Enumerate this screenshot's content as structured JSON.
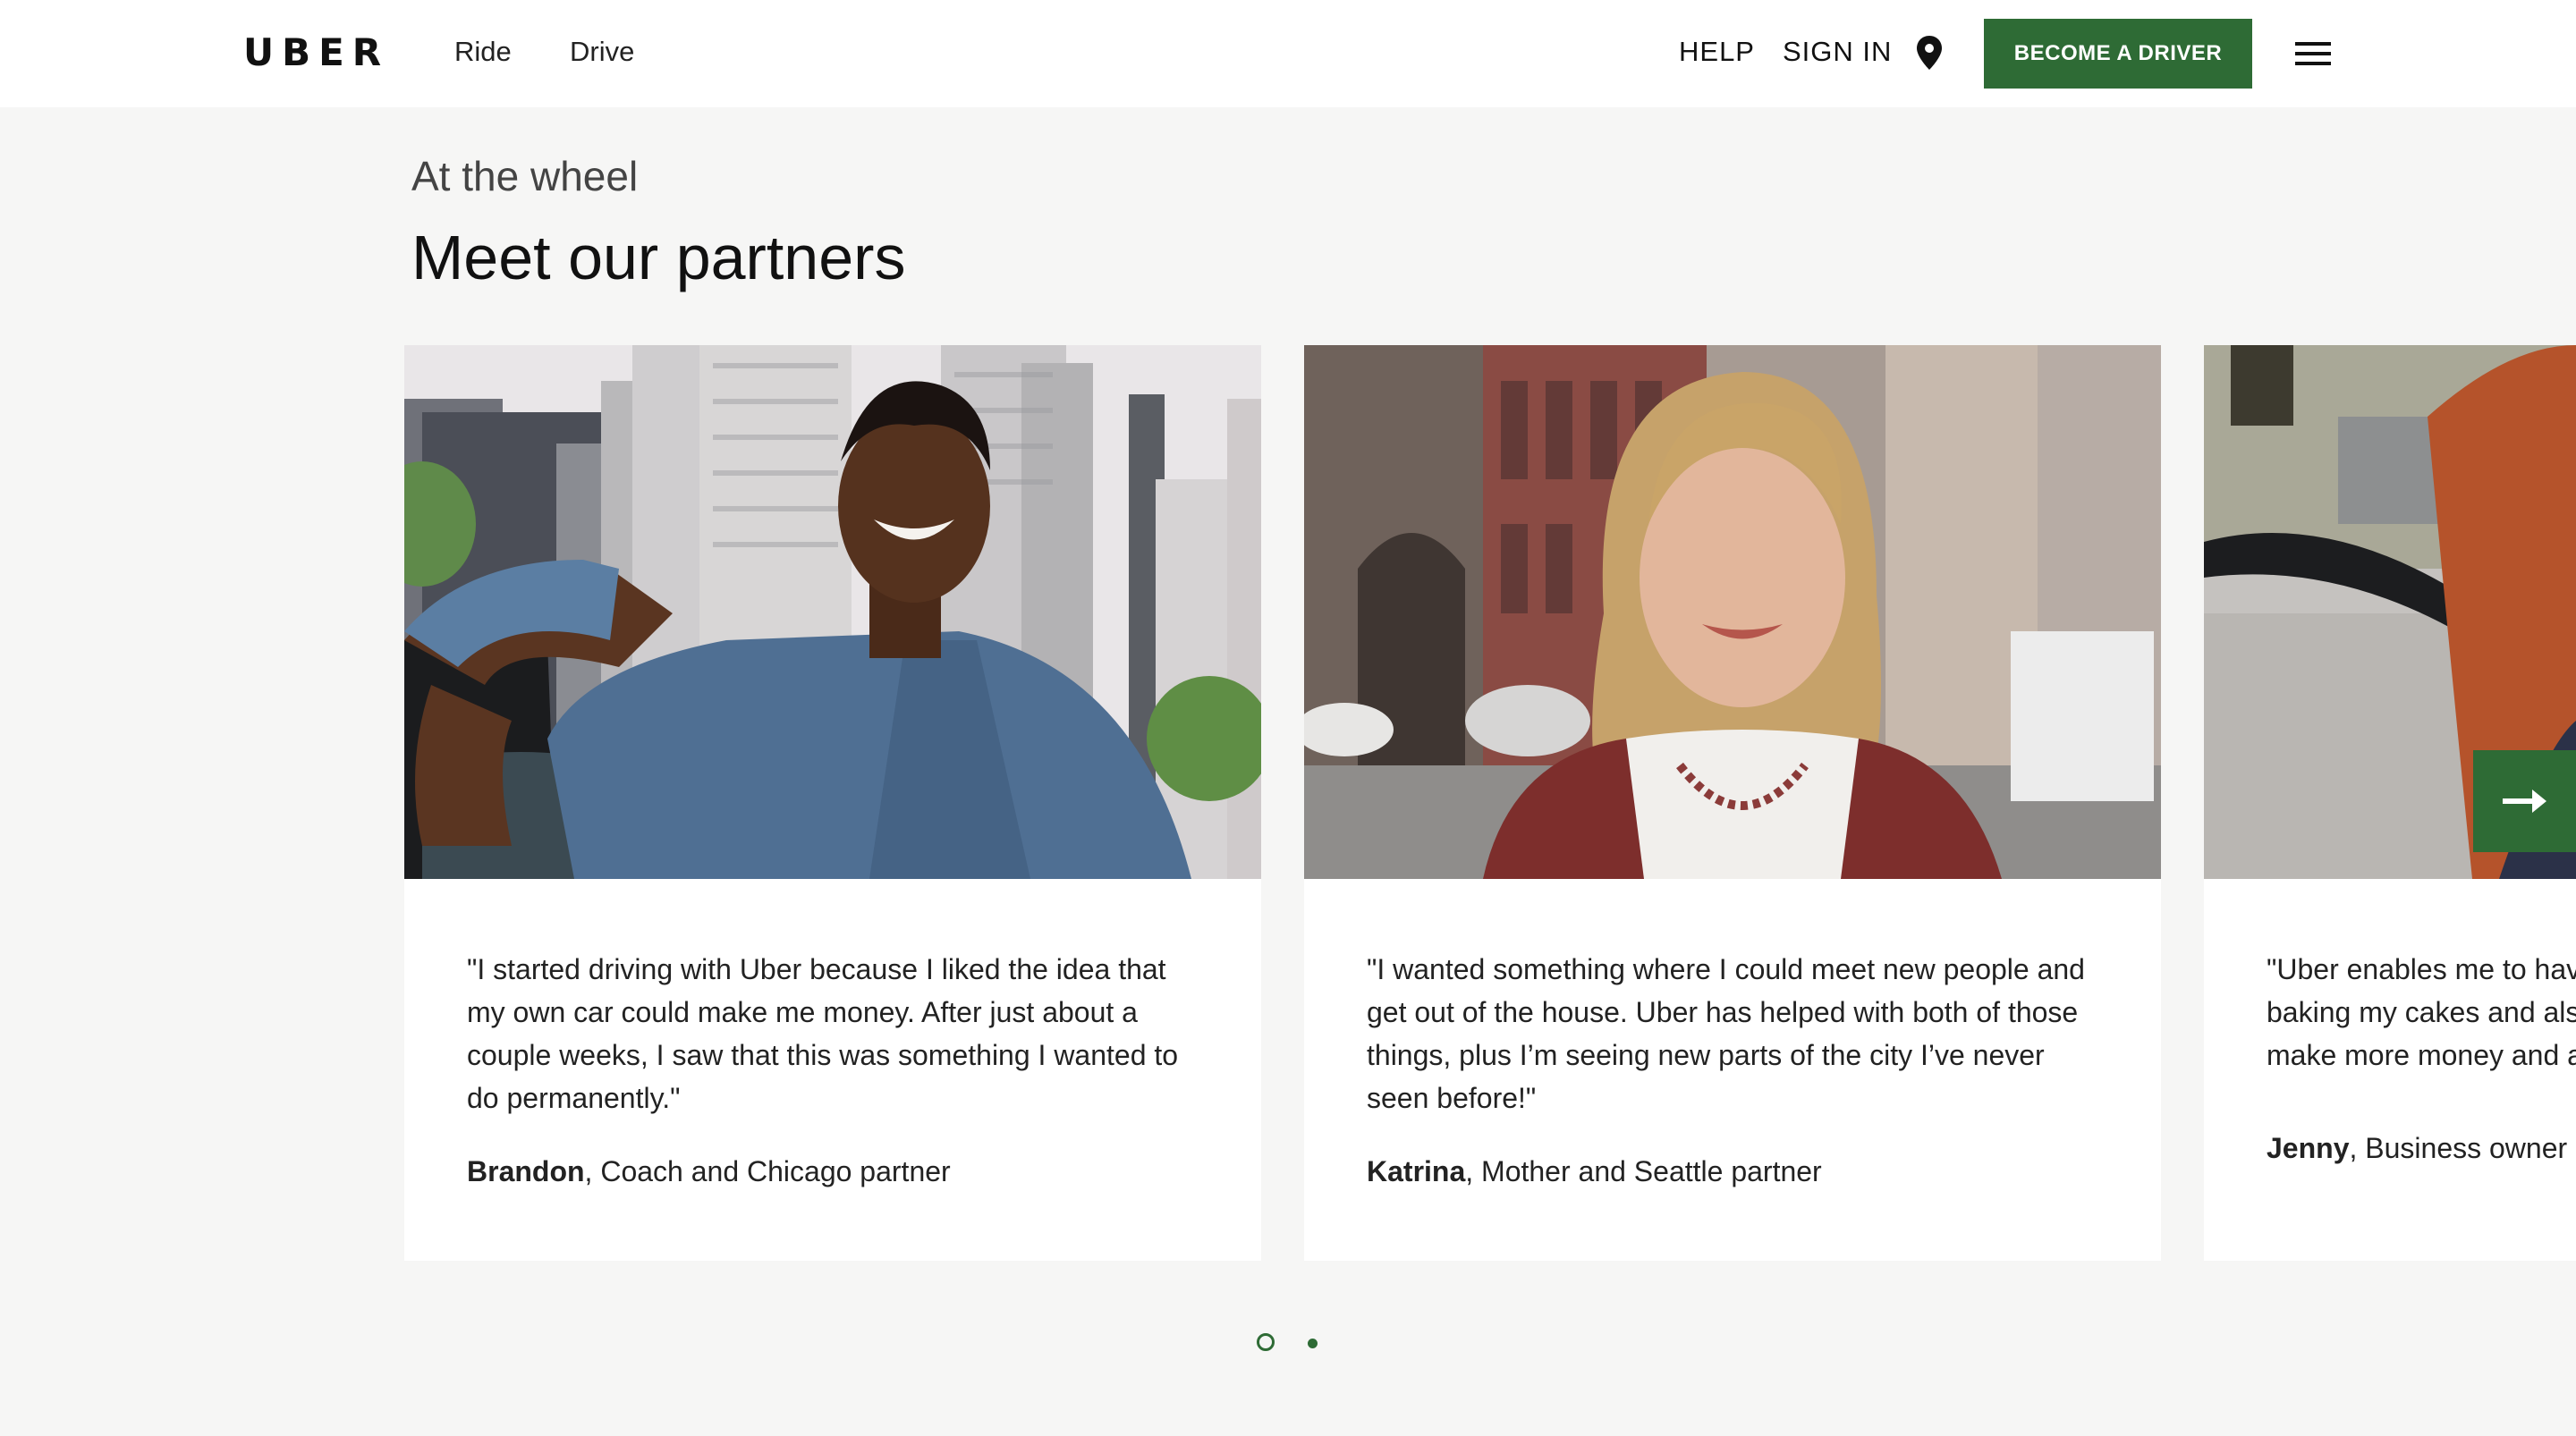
{
  "header": {
    "logo": "UBER",
    "nav": [
      "Ride",
      "Drive"
    ],
    "help": "HELP",
    "sign_in": "SIGN IN",
    "become_driver": "BECOME A DRIVER",
    "icons": [
      "location-pin-icon",
      "hamburger-menu-icon"
    ]
  },
  "section": {
    "eyebrow": "At the wheel",
    "title": "Meet our partners"
  },
  "partners": [
    {
      "quote_lines": [
        "\"I started driving with Uber because I liked the idea that",
        "my own car could make me money. After just about a",
        "couple weeks, I saw that this was something I wanted to",
        "do permanently.\""
      ],
      "name": "Brandon",
      "role": ", Coach and Chicago partner"
    },
    {
      "quote_lines": [
        "\"I wanted something where I could meet new people and",
        "get out of the house. Uber has helped with both of those",
        "things, plus I’m seeing new parts of the city I’ve never",
        "seen before!\""
      ],
      "name": "Katrina",
      "role": ", Mother and Seattle partner"
    },
    {
      "quote_lines": [
        "\"Uber enables me to hav",
        "baking my cakes and als",
        "make more money and a"
      ],
      "name": "Jenny",
      "role": ", Business owner a"
    }
  ],
  "carousel": {
    "next_icon": "arrow-right-icon",
    "pages": 2,
    "active_page": 1
  },
  "colors": {
    "accent": "#2e6b35",
    "background": "#f6f6f5"
  }
}
